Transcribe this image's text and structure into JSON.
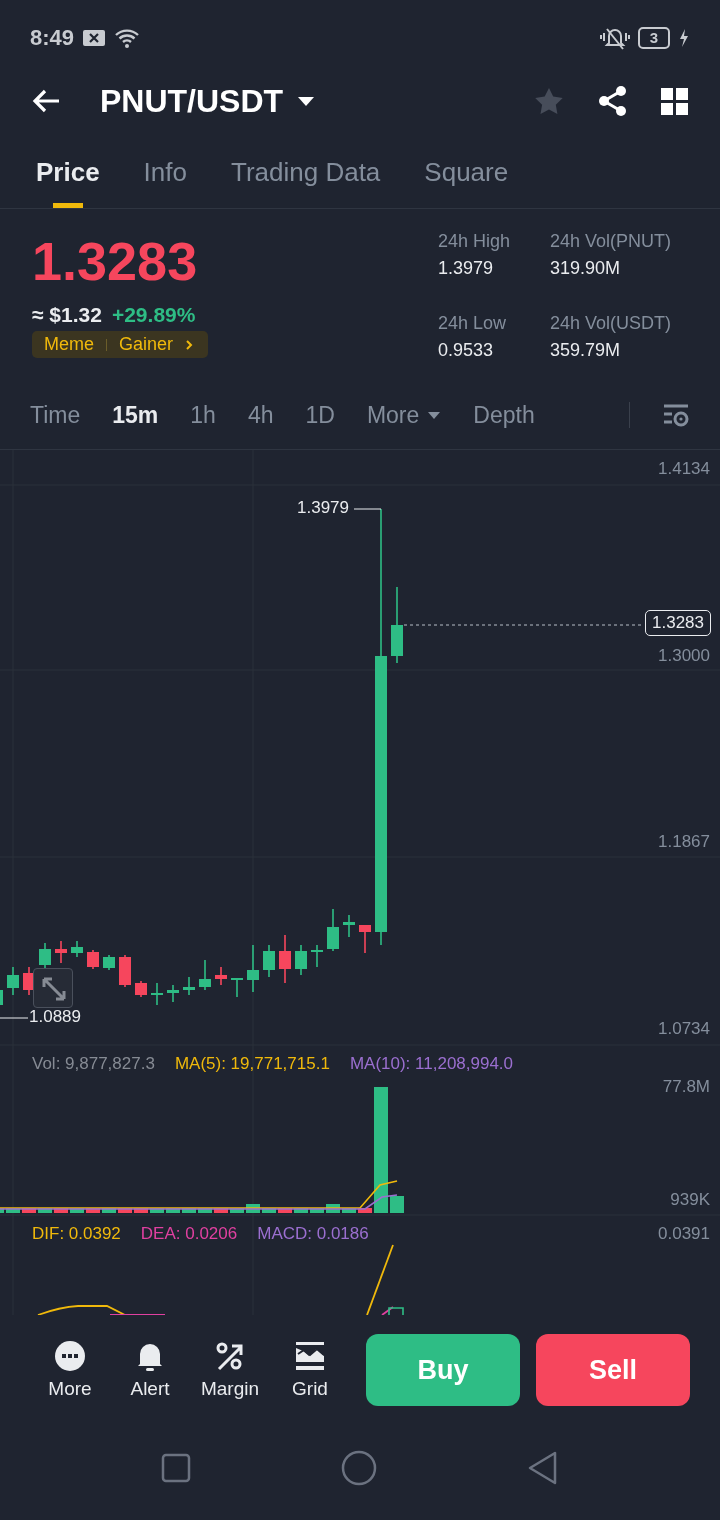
{
  "status_bar": {
    "time": "8:49",
    "battery": "3"
  },
  "header": {
    "pair": "PNUT/USDT",
    "favorite": false
  },
  "tabs": [
    {
      "label": "Price",
      "selected": true
    },
    {
      "label": "Info",
      "selected": false
    },
    {
      "label": "Trading Data",
      "selected": false
    },
    {
      "label": "Square",
      "selected": false
    }
  ],
  "ticker": {
    "price": "1.3283",
    "usd": "≈ $1.32",
    "change": "+29.89%",
    "tags": [
      "Meme",
      "Gainer"
    ],
    "stats": [
      {
        "label": "24h High",
        "value": "1.3979"
      },
      {
        "label": "24h Vol(PNUT)",
        "value": "319.90M"
      },
      {
        "label": "24h Low",
        "value": "0.9533"
      },
      {
        "label": "24h Vol(USDT)",
        "value": "359.79M"
      }
    ]
  },
  "intervals": [
    {
      "label": "Time",
      "kind": "option",
      "selected": false
    },
    {
      "label": "15m",
      "kind": "option",
      "selected": true
    },
    {
      "label": "1h",
      "kind": "option",
      "selected": false
    },
    {
      "label": "4h",
      "kind": "option",
      "selected": false
    },
    {
      "label": "1D",
      "kind": "option",
      "selected": false
    },
    {
      "label": "More",
      "kind": "menu",
      "selected": false
    },
    {
      "label": "Depth",
      "kind": "option",
      "selected": false
    }
  ],
  "chart": {
    "axis_labels": [
      "1.4134",
      "1.3000",
      "1.1867",
      "1.0734"
    ],
    "high_label": "1.3979",
    "low_label": "1.0889",
    "current_price": "1.3283"
  },
  "volume": {
    "legend": [
      {
        "text": "Vol: 9,877,827.3",
        "color": "#868b94"
      },
      {
        "text": "MA(5): 19,771,715.1",
        "color": "#f0b90b"
      },
      {
        "text": "MA(10): 11,208,994.0",
        "color": "#9b6fd0"
      }
    ],
    "axis_labels": [
      "77.8M",
      "939K"
    ]
  },
  "macd": {
    "legend": [
      {
        "text": "DIF: 0.0392",
        "color": "#f0b90b"
      },
      {
        "text": "DEA: 0.0206",
        "color": "#e040a0"
      },
      {
        "text": "MACD: 0.0186",
        "color": "#9b6fd0"
      }
    ],
    "axis_label": "0.0391"
  },
  "toolbar": [
    {
      "label": "More",
      "kind": "more"
    },
    {
      "label": "Alert",
      "kind": "alert"
    },
    {
      "label": "Margin",
      "kind": "margin"
    },
    {
      "label": "Grid",
      "kind": "grid"
    }
  ],
  "actions": [
    {
      "label": "Buy",
      "kind": "buy"
    },
    {
      "label": "Sell",
      "kind": "sell"
    }
  ]
}
